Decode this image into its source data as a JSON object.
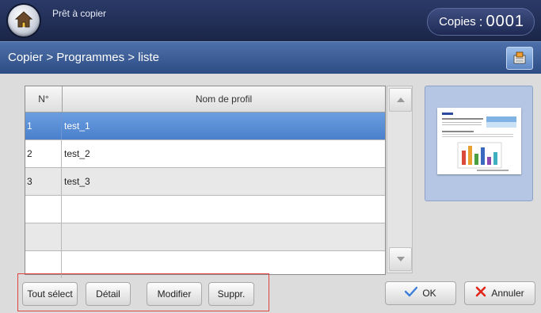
{
  "header": {
    "status": "Prêt à copier",
    "copies_label": "Copies",
    "copies_sep": ":",
    "copies_value": "0001"
  },
  "nav": {
    "breadcrumb": "Copier > Programmes > liste"
  },
  "table": {
    "columns": [
      "N°",
      "Nom de profil"
    ],
    "rows": [
      {
        "n": "1",
        "name": "test_1",
        "selected": true
      },
      {
        "n": "2",
        "name": "test_2",
        "selected": false
      },
      {
        "n": "3",
        "name": "test_3",
        "selected": false
      },
      {
        "n": "",
        "name": "",
        "selected": false
      },
      {
        "n": "",
        "name": "",
        "selected": false
      },
      {
        "n": "",
        "name": "",
        "selected": false
      }
    ]
  },
  "buttons": {
    "select_all": "Tout sélect",
    "detail": "Détail",
    "modify": "Modifier",
    "delete": "Suppr.",
    "ok": "OK",
    "cancel": "Annuler"
  },
  "colors": {
    "ok_check": "#3d7fd8",
    "cancel_x": "#e0251b",
    "highlight_border": "#e0433d",
    "selected_row": "#5a8ed6"
  },
  "icons": {
    "home": "home-icon",
    "nav_button": "document-icon",
    "scroll_up": "triangle-up-icon",
    "scroll_down": "triangle-down-icon",
    "ok": "checkmark-icon",
    "cancel": "x-icon"
  }
}
